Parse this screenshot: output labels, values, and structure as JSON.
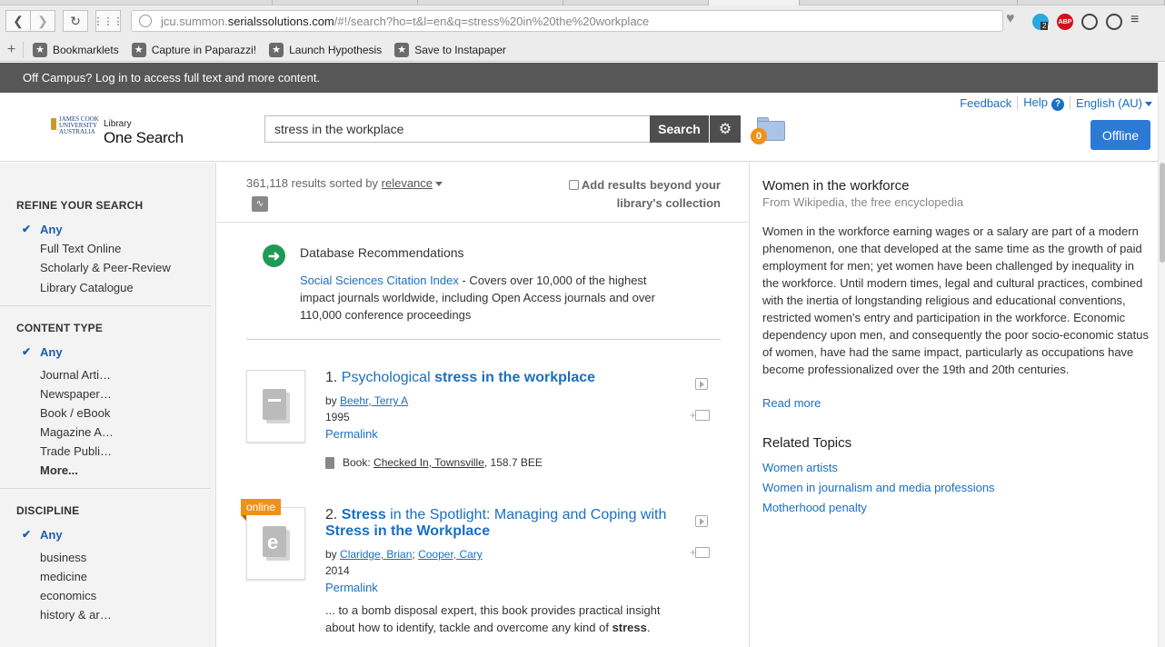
{
  "browser": {
    "url_prefix": "jcu.summon.",
    "url_host": "serialssolutions.com",
    "url_path": "/#!/search?ho=t&l=en&q=stress%20in%20the%20workplace",
    "bookmarks": [
      "Bookmarklets",
      "Capture in Paparazzi!",
      "Launch Hypothesis",
      "Save to Instapaper"
    ],
    "ext_badge": "2",
    "abp_label": "ABP"
  },
  "banner": {
    "text": "Off Campus? Log in to access full text and more content."
  },
  "header": {
    "logo_univ": "JAMES COOK\nUNIVERSITY\nAUSTRALIA",
    "logo_library": "Library",
    "logo_name": "One Search",
    "search_value": "stress in the workplace",
    "search_button": "Search",
    "folder_count": "0",
    "feedback": "Feedback",
    "help": "Help",
    "help_icon": "?",
    "language": "English (AU)",
    "offline": "Offline"
  },
  "sidebar": {
    "refine": {
      "title": "REFINE YOUR SEARCH",
      "any": "Any",
      "items": [
        "Full Text Online",
        "Scholarly & Peer-Review",
        "Library Catalogue"
      ]
    },
    "content_type": {
      "title": "CONTENT TYPE",
      "any": "Any",
      "items": [
        "Journal Arti…",
        "Newspaper…",
        "Book / eBook",
        "Magazine A…",
        "Trade Publi…"
      ],
      "more": "More..."
    },
    "discipline": {
      "title": "DISCIPLINE",
      "any": "Any",
      "items": [
        "business",
        "medicine",
        "economics",
        "history & ar…"
      ]
    }
  },
  "results": {
    "count_text": "361,118 results sorted by",
    "sort": "relevance",
    "beyond_label": "Add results beyond your library's collection",
    "db_rec": {
      "title": "Database Recommendations",
      "link": "Social Sciences Citation Index",
      "desc": " - Covers over 10,000 of the highest impact journals worldwide, including Open Access journals and over 110,000 conference proceedings"
    },
    "items": [
      {
        "num": "1.",
        "title_pre": "Psychological ",
        "title_bold": "stress in the workplace",
        "by": "by",
        "authors": [
          "Beehr, Terry A"
        ],
        "year": "1995",
        "permalink": "Permalink",
        "holding_prefix": "Book:",
        "holding_link": "Checked In, Townsville",
        "holding_suffix": ", 158.7 BEE"
      },
      {
        "num": "2.",
        "badge": "online",
        "title_bold1": "Stress",
        "title_mid": " in the Spotlight: Managing and Coping with ",
        "title_bold2": "Stress in the Workplace",
        "by": "by",
        "authors": [
          "Claridge, Brian",
          "Cooper, Cary"
        ],
        "year": "2014",
        "permalink": "Permalink",
        "snippet_pre": "... to a bomb disposal expert, this book provides practical insight about how to identify, tackle and overcome any kind of ",
        "snippet_bold": "stress",
        "snippet_post": "."
      }
    ]
  },
  "panel": {
    "title": "Women in the workforce",
    "source": "From Wikipedia, the free encyclopedia",
    "body": "Women in the workforce earning wages or a salary are part of a modern phenomenon, one that developed at the same time as the growth of paid employment for men; yet women have been challenged by inequality in the workforce. Until modern times, legal and cultural practices, combined with the inertia of longstanding religious and educational conventions, restricted women's entry and participation in the workforce. Economic dependency upon men, and consequently the poor socio-economic status of women, have had the same impact, particularly as occupations have become professionalized over the 19th and 20th centuries.",
    "read_more": "Read more",
    "related_title": "Related Topics",
    "topics": [
      "Women artists",
      "Women in journalism and media professions",
      "Motherhood penalty"
    ]
  },
  "colors": {
    "link": "#1a6fc2",
    "banner": "#575757",
    "button": "#4e4e4e",
    "offline": "#2d7ad6",
    "badge": "#f0911a"
  }
}
